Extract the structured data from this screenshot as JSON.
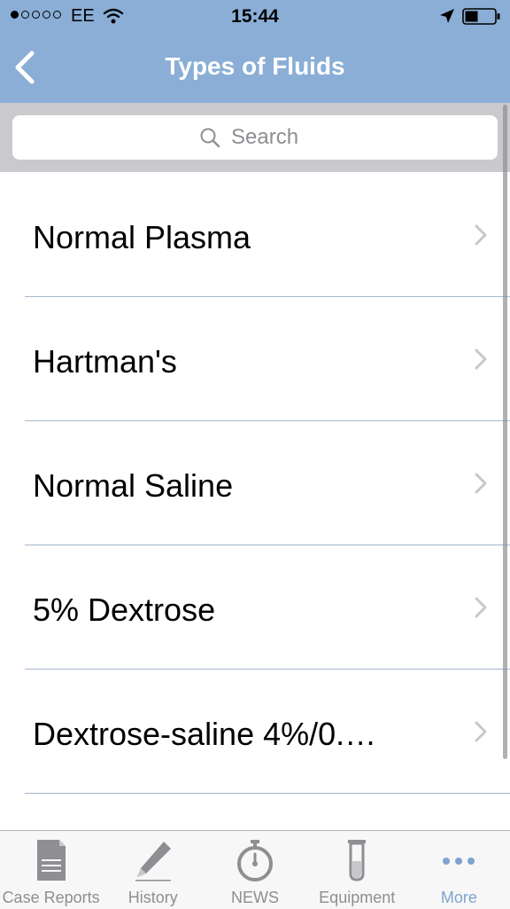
{
  "status_bar": {
    "carrier": "EE",
    "time": "15:44",
    "signal_filled": 1,
    "signal_total": 5
  },
  "nav": {
    "title": "Types of Fluids",
    "back_icon": "chevron-left-icon"
  },
  "search": {
    "placeholder": "Search",
    "value": ""
  },
  "list": {
    "items": [
      {
        "label": "Normal Plasma"
      },
      {
        "label": "Hartman's"
      },
      {
        "label": "Normal Saline"
      },
      {
        "label": "5% Dextrose"
      },
      {
        "label": "Dextrose-saline 4%/0.…"
      }
    ]
  },
  "tab_bar": {
    "tabs": [
      {
        "label": "Case Reports",
        "icon": "document-icon"
      },
      {
        "label": "History",
        "icon": "pencil-icon"
      },
      {
        "label": "NEWS",
        "icon": "stopwatch-icon"
      },
      {
        "label": "Equipment",
        "icon": "test-tube-icon"
      },
      {
        "label": "More",
        "icon": "more-dots-icon"
      }
    ],
    "active_index": 4
  },
  "colors": {
    "nav_bar": "#8aaed6",
    "search_bar_bg": "#c9c9ce",
    "separator": "#a5b8cf",
    "tab_active": "#7ea3cf",
    "tab_inactive": "#8e8e93"
  }
}
